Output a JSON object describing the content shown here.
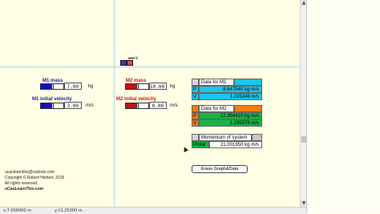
{
  "m1": {
    "mass_label": "M1 mass",
    "mass_value": "7.00",
    "mass_unit": "kg",
    "mass_fill_fraction": 0.45,
    "velocity_label": "M1 initial velocity",
    "velocity_value": "3.00",
    "velocity_unit": "m/s",
    "velocity_fill_fraction": 0.45
  },
  "m2": {
    "mass_label": "M2 mass",
    "mass_value": "10.00",
    "mass_unit": "kg",
    "mass_fill_fraction": 0.45,
    "velocity_label": "M2 initial velocity",
    "velocity_value": "0.00",
    "velocity_unit": "m/s",
    "velocity_fill_fraction": 0.45
  },
  "object_label": "v",
  "data_m1": {
    "title": "Data for M1",
    "p_key": "P",
    "p_value": "8.647540 kg·m/s",
    "v_key": "V",
    "v_value": "1.235248 m/s"
  },
  "data_m2": {
    "title": "Data for M2",
    "p_key": "P",
    "p_value": "12.354410 kg·m/s",
    "v_key": "V",
    "v_value": "1.235379 m/s"
  },
  "momentum": {
    "title": "Momentum of system",
    "key": "Ptotal",
    "value": "21.001950 kg·m/s"
  },
  "erase_button": "Erase Graph&Data",
  "credits": {
    "email": "ucanlearnthis@outlook.com",
    "copyright": "Copyright © Robert Hiebert, 2016",
    "rights": "All rights reserved.",
    "site": "uCanLearnThis.com"
  },
  "status": {
    "x_readout": "x:7.000000   m",
    "y_readout": "y:11.25000   m"
  },
  "colors": {
    "blue": "#1010c8",
    "red": "#c81010",
    "cyan": "#19c6ee",
    "orange": "#f07c10",
    "green": "#10b840",
    "gray": "#c8c8c8"
  }
}
